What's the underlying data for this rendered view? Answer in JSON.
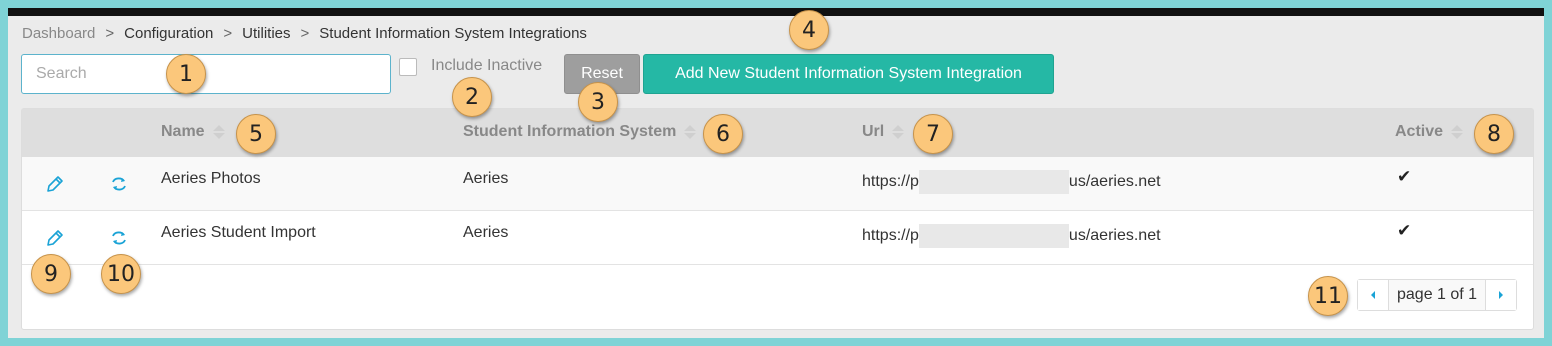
{
  "breadcrumb": {
    "items": [
      "Dashboard",
      "Configuration",
      "Utilities",
      "Student Information System Integrations"
    ],
    "separator": ">"
  },
  "toolbar": {
    "search_placeholder": "Search",
    "include_inactive_label": "Include Inactive",
    "reset_label": "Reset",
    "add_label": "Add New Student Information System Integration"
  },
  "table": {
    "columns": [
      "Name",
      "Student Information System",
      "Url",
      "Active"
    ],
    "rows": [
      {
        "name": "Aeries Photos",
        "sis": "Aeries",
        "url_prefix": "https://p",
        "url_suffix": "us/aeries.net",
        "active": "✔"
      },
      {
        "name": "Aeries Student Import",
        "sis": "Aeries",
        "url_prefix": "https://p",
        "url_suffix": "us/aeries.net",
        "active": "✔"
      }
    ],
    "row_icons": [
      "pencil-icon",
      "sync-icon"
    ]
  },
  "pagination": {
    "label": "page 1 of 1"
  },
  "callouts": [
    "1",
    "2",
    "3",
    "4",
    "5",
    "6",
    "7",
    "8",
    "9",
    "10",
    "11"
  ],
  "colors": {
    "accent": "#25b8a5",
    "icon": "#1aa3d6",
    "callout": "#fbc77b",
    "outline": "#7fd3d6"
  }
}
